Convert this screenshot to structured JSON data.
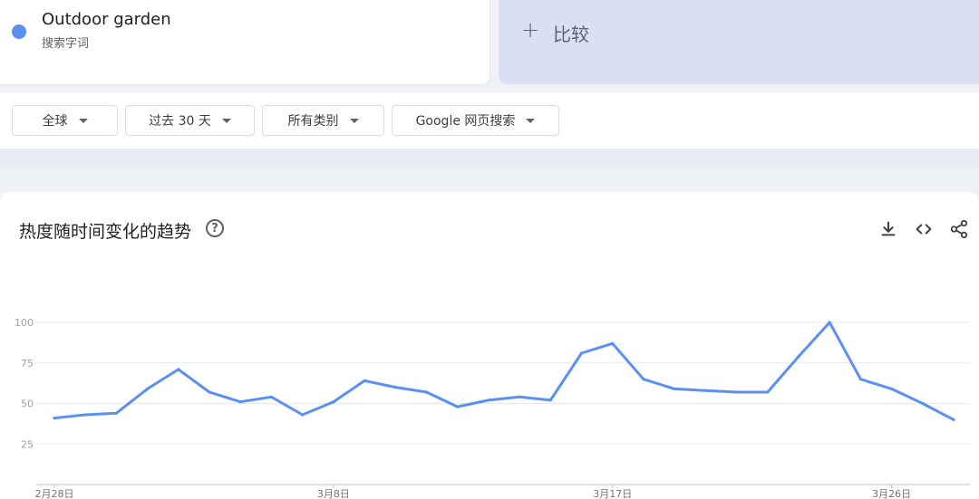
{
  "term": {
    "name": "Outdoor garden",
    "sub": "搜索字词",
    "color": "#5b8ff3"
  },
  "compare": {
    "plus": "+",
    "label": "比较"
  },
  "filters": [
    {
      "label": "全球"
    },
    {
      "label": "过去 30 天"
    },
    {
      "label": "所有类别"
    },
    {
      "label": "Google 网页搜索"
    }
  ],
  "chart": {
    "title": "热度随时间变化的趋势",
    "help": "?",
    "icons": [
      "download-icon",
      "embed-icon",
      "share-icon"
    ]
  },
  "chart_data": {
    "type": "line",
    "x": [
      "2月28日",
      "2月29日",
      "3月1日",
      "3月2日",
      "3月3日",
      "3月4日",
      "3月5日",
      "3月6日",
      "3月7日",
      "3月8日",
      "3月9日",
      "3月10日",
      "3月11日",
      "3月12日",
      "3月13日",
      "3月14日",
      "3月15日",
      "3月16日",
      "3月17日",
      "3月18日",
      "3月19日",
      "3月20日",
      "3月21日",
      "3月22日",
      "3月23日",
      "3月24日",
      "3月25日",
      "3月26日",
      "3月27日",
      "3月28日"
    ],
    "series": [
      {
        "color": "#5b8ff3",
        "values": [
          41,
          43,
          44,
          59,
          71,
          57,
          51,
          54,
          43,
          51,
          64,
          60,
          57,
          48,
          52,
          54,
          52,
          81,
          87,
          65,
          59,
          58,
          57,
          57,
          79,
          100,
          65,
          59,
          50,
          40
        ]
      }
    ],
    "yticks": [
      25,
      50,
      75,
      100
    ],
    "xtick_labels": [
      "2月28日",
      "3月8日",
      "3月17日",
      "3月26日"
    ],
    "ylim": [
      0,
      100
    ],
    "grid": true
  }
}
